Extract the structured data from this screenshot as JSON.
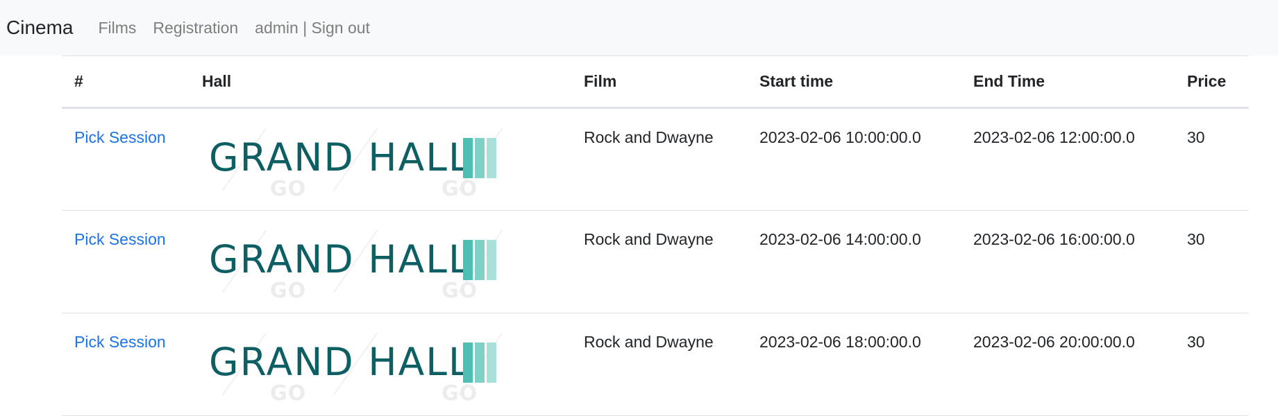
{
  "navbar": {
    "brand": "Cinema",
    "links": [
      {
        "label": "Films"
      },
      {
        "label": "Registration"
      },
      {
        "label": "admin | Sign out"
      }
    ]
  },
  "table": {
    "headers": [
      "#",
      "Hall",
      "Film",
      "Start time",
      "End Time",
      "Price"
    ],
    "rows": [
      {
        "action": "Pick Session",
        "hall_logo_text": "GRAND HALL",
        "film": "Rock and Dwayne",
        "start": "2023-02-06 10:00:00.0",
        "end": "2023-02-06 12:00:00.0",
        "price": "30"
      },
      {
        "action": "Pick Session",
        "hall_logo_text": "GRAND HALL",
        "film": "Rock and Dwayne",
        "start": "2023-02-06 14:00:00.0",
        "end": "2023-02-06 16:00:00.0",
        "price": "30"
      },
      {
        "action": "Pick Session",
        "hall_logo_text": "GRAND HALL",
        "film": "Rock and Dwayne",
        "start": "2023-02-06 18:00:00.0",
        "end": "2023-02-06 20:00:00.0",
        "price": "30"
      }
    ]
  },
  "colors": {
    "navbar_bg": "#f8f9fa",
    "link": "#1a73e8",
    "logo_text": "#0d5f63",
    "logo_bars": [
      "#4fbfb3",
      "#7fd1c8",
      "#a9e0da"
    ]
  }
}
